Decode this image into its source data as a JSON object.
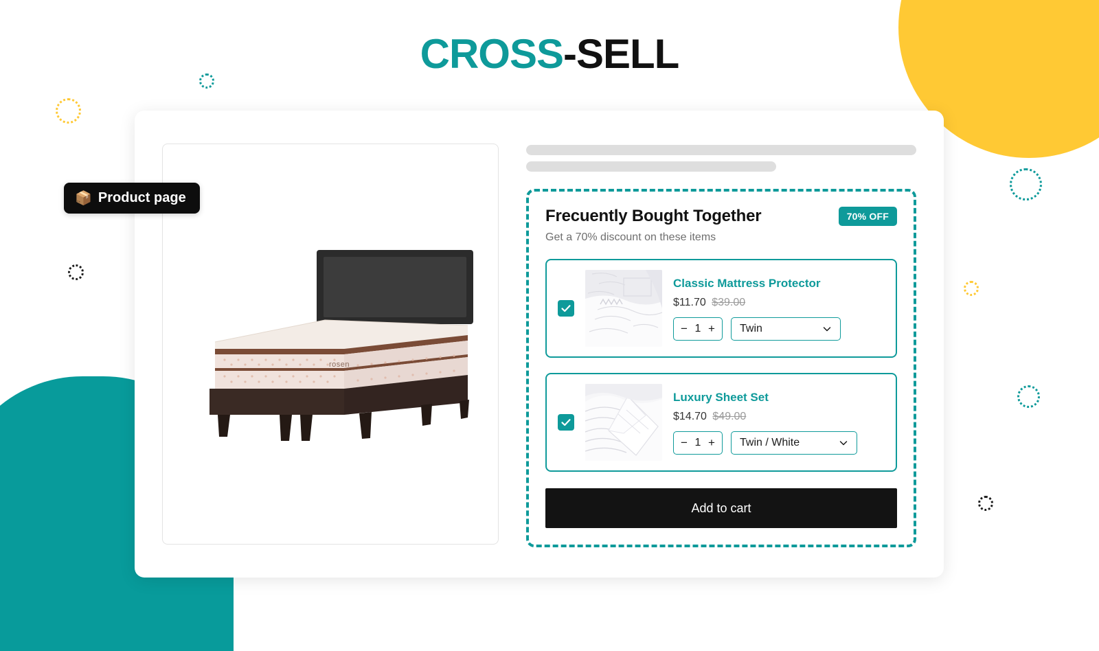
{
  "title": {
    "accent": "CROSS",
    "rest": "-SELL"
  },
  "badge_pill": {
    "icon": "package-icon",
    "emoji": "📦",
    "label": "Product page"
  },
  "fbt": {
    "heading": "Frecuently Bought Together",
    "subheading": "Get a 70% discount on these items",
    "discount_badge": "70% OFF",
    "add_to_cart_label": "Add to cart",
    "accent_color": "#0E9A9A",
    "products": [
      {
        "name": "Classic Mattress Protector",
        "price": "$11.70",
        "compare_at_price": "$39.00",
        "quantity": "1",
        "variant": "Twin",
        "checked": true,
        "decrement_label": "−",
        "increment_label": "+",
        "image_alt": "white-quilted-mattress-protector"
      },
      {
        "name": "Luxury Sheet Set",
        "price": "$14.70",
        "compare_at_price": "$49.00",
        "quantity": "1",
        "variant": "Twin / White",
        "checked": true,
        "decrement_label": "−",
        "increment_label": "+",
        "image_alt": "white-folded-sheet-set"
      }
    ]
  },
  "gallery": {
    "image_alt": "rosen-bed-with-mattress-and-headboard",
    "brand_on_mattress": "rosen"
  },
  "decor": {
    "yellow": "#FFC934",
    "teal": "#089B9B",
    "dark": "#1b1b1b"
  }
}
